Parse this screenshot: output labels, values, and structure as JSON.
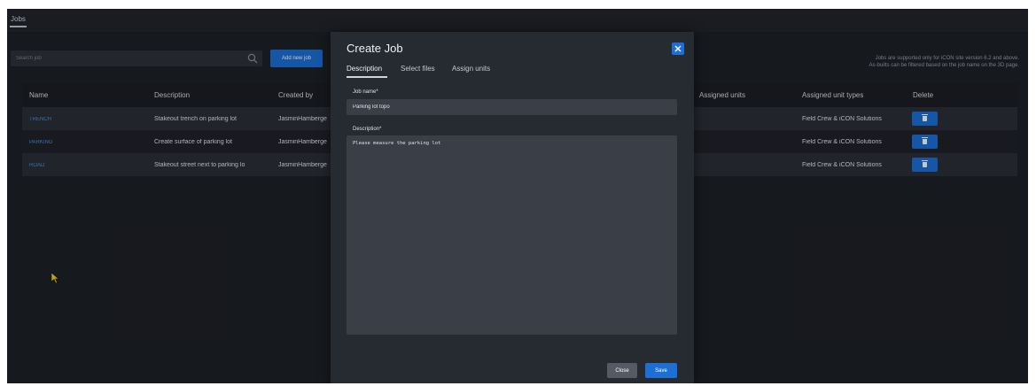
{
  "header": {
    "tab_label": "Jobs"
  },
  "toolbar": {
    "search_placeholder": "Search job",
    "add_button_label": "Add new job",
    "notice_line1": "Jobs are supported only for iCON site version 6.2 and above.",
    "notice_line2": "As-builts can be filtered based on the job name on the 3D page."
  },
  "table": {
    "columns": [
      "Name",
      "Description",
      "Created by",
      "Assigned units",
      "Assigned unit types",
      "Delete"
    ],
    "rows": [
      {
        "name": "TRENCH",
        "description": "Stakeout trench on parking lot",
        "created_by": "JasminHamberge",
        "assigned_unit_types": "Field Crew & iCON Solutions"
      },
      {
        "name": "PARKING",
        "description": "Create surface of parking lot",
        "created_by": "JasminHamberge",
        "assigned_unit_types": "Field Crew & iCON Solutions"
      },
      {
        "name": "ROAD",
        "description": "Stakeout street next to parking lo",
        "created_by": "JasminHamberge",
        "assigned_unit_types": "Field Crew & iCON Solutions"
      }
    ]
  },
  "modal": {
    "title": "Create Job",
    "tabs": [
      "Description",
      "Select files",
      "Assign units"
    ],
    "active_tab": "Description",
    "job_name_label": "Job name*",
    "job_name_value": "Parking lot topo",
    "description_label": "Description*",
    "description_value": "Please measure the parking lot",
    "close_label": "Close",
    "save_label": "Save"
  },
  "colors": {
    "accent": "#1d6fd6",
    "link": "#4a90e2",
    "background": "#1d2026",
    "cursor": "#f2d21b"
  }
}
